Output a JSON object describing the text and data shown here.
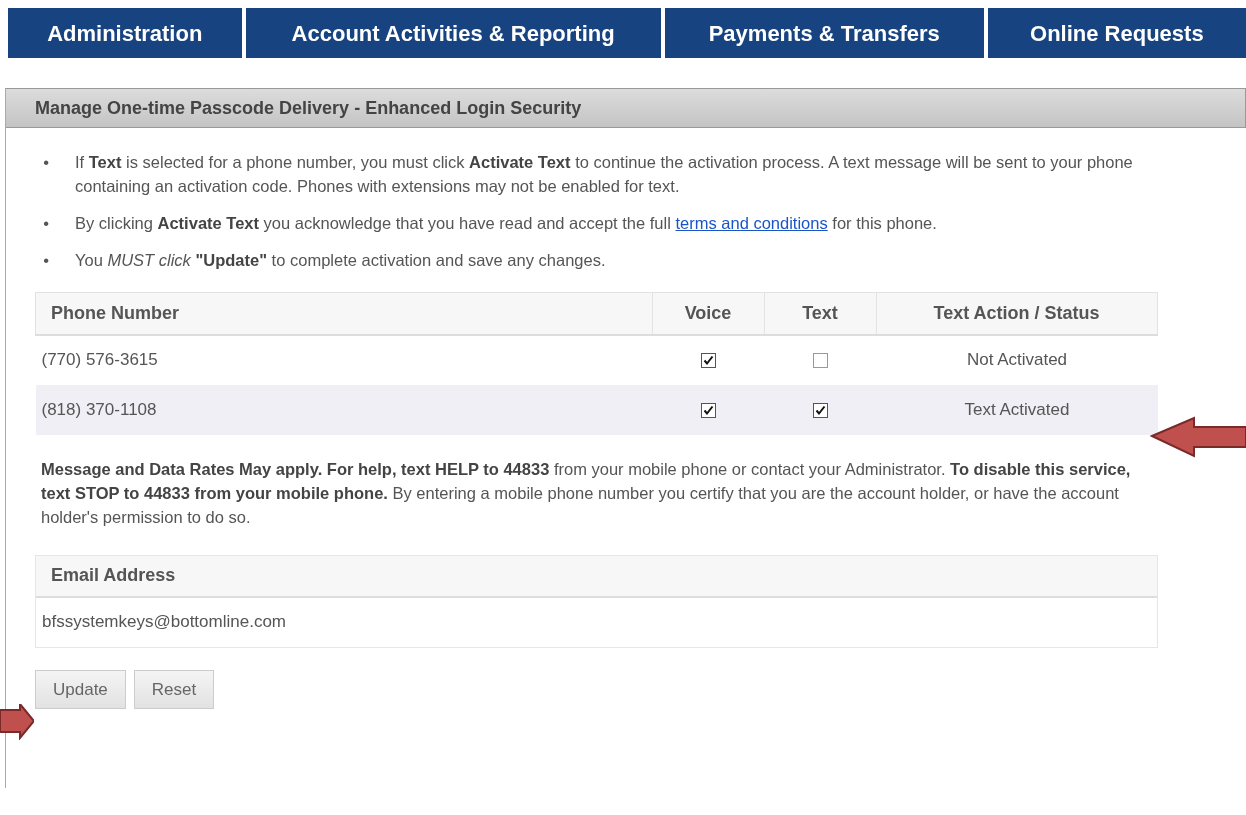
{
  "nav_tabs": [
    {
      "label": "Administration"
    },
    {
      "label": "Account Activities & Reporting"
    },
    {
      "label": "Payments & Transfers"
    },
    {
      "label": "Online Requests"
    }
  ],
  "panel": {
    "title": "Manage One-time Passcode Delivery - Enhanced Login Security",
    "bullets": [
      {
        "marker": "•",
        "text": "If **Text** is selected for a phone number, you must click **Activate Text** to continue the activation process. A text message will be sent to your phone containing an activation code. Phones with extensions may not be enabled for text."
      },
      {
        "marker": "•",
        "text": "By clicking **Activate Text** you acknowledge that you have read and accept the full ",
        "link": "terms and conditions",
        "text_after": " for this phone."
      },
      {
        "marker": "•",
        "text": "You *MUST click* **\"Update\"** to complete activation and save any changes."
      }
    ],
    "phone_table": {
      "columns": [
        "Phone Number",
        "Voice",
        "Text",
        "Text Action / Status"
      ],
      "rows": [
        {
          "phone": "(770) 576-3615",
          "voice": true,
          "text": false,
          "status": "Not Activated",
          "highlighted": false
        },
        {
          "phone": "(818) 370-1108",
          "voice": true,
          "text": true,
          "status": "Text Activated",
          "highlighted": true
        }
      ]
    },
    "notice": "**Message and Data Rates May apply. For help, text HELP to 44833** from your mobile phone or contact your Administrator. **To disable this service, text STOP to 44833 from your mobile phone.** By entering a mobile phone number you certify that you are the account holder, or have the account holder's permission to do so.",
    "email_table": {
      "column": "Email Address",
      "value": "bfssystemkeys@bottomline.com"
    },
    "buttons": [
      "Update",
      "Reset"
    ]
  }
}
